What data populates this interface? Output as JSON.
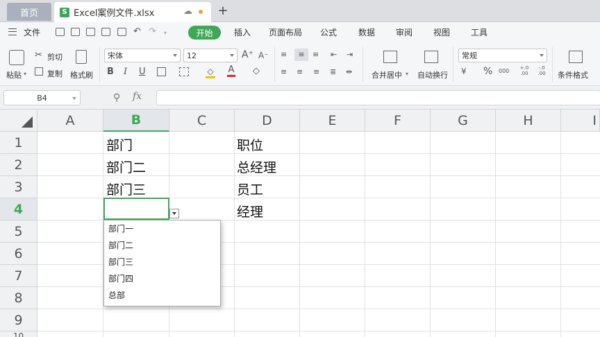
{
  "tabs": {
    "home": "首页",
    "file_icon": "S",
    "file_name": "Excel案例文件.xlsx",
    "add": "+"
  },
  "menu": {
    "file": "文件",
    "items": [
      "开始",
      "插入",
      "页面布局",
      "公式",
      "数据",
      "审阅",
      "视图",
      "工具"
    ]
  },
  "ribbon": {
    "paste": "粘贴",
    "cut": "剪切",
    "copy": "复制",
    "format_painter": "格式刷",
    "font_name": "宋体",
    "font_size": "12",
    "bold": "B",
    "italic": "I",
    "underline": "U",
    "merge_center": "合并居中",
    "wrap_text": "自动换行",
    "number_format": "常规",
    "percent": "%",
    "thousands": "000",
    "dec_inc": "+.0 .00",
    "dec_dec": "-.0 .00",
    "conditional_format": "条件格式"
  },
  "formula_bar": {
    "cell_ref": "B4",
    "fx": "fx",
    "value": ""
  },
  "grid": {
    "columns": [
      "A",
      "B",
      "C",
      "D",
      "E",
      "F",
      "G",
      "H",
      "I"
    ],
    "rows": [
      "1",
      "2",
      "3",
      "4",
      "5",
      "6",
      "7",
      "8",
      "9",
      "10"
    ],
    "selected_column": "B",
    "selected_row": "4",
    "cells": {
      "B1": "部门",
      "B2": "部门二",
      "B3": "部门三",
      "D1": "职位",
      "D2": "总经理",
      "D3": "员工",
      "D4": "经理"
    }
  },
  "dropdown": {
    "options": [
      "部门一",
      "部门二",
      "部门三",
      "部门四",
      "总部"
    ]
  },
  "colors": {
    "accent": "#3ea857",
    "tab_bg": "#dcdee2",
    "header_bg": "#f0f1f3"
  }
}
